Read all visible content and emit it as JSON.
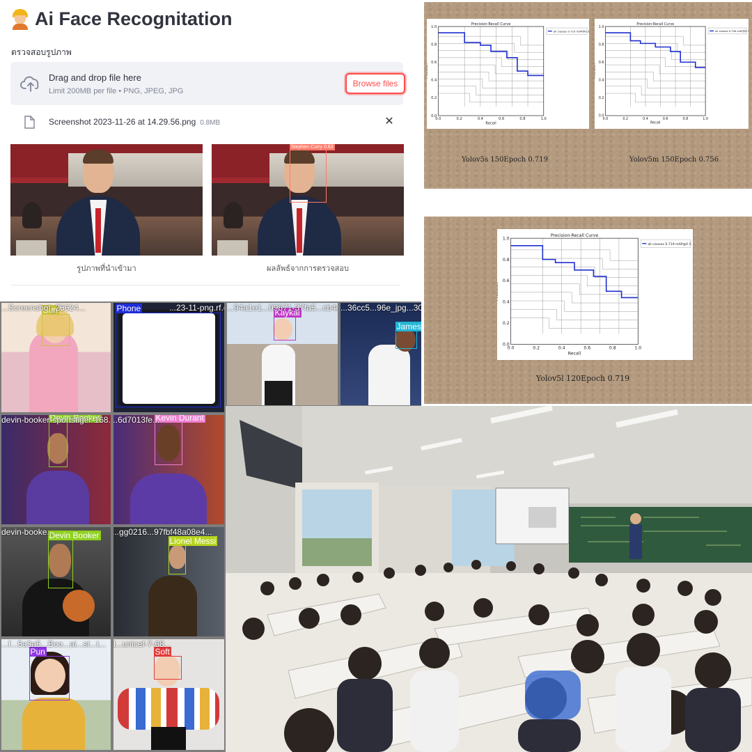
{
  "app": {
    "title": "Ai Face Recognitation",
    "title_icon": "construction-worker-icon",
    "uploader_label": "ตรวจสอบรูปภาพ",
    "dropzone": {
      "main_text": "Drag and drop file here",
      "sub_text": "Limit 200MB per file • PNG, JPEG, JPG",
      "browse_label": "Browse files"
    },
    "uploaded_file": {
      "name": "Screenshot 2023-11-26 at 14.29.56.png",
      "size": "0.8MB"
    },
    "images": [
      {
        "caption": "รูปภาพที่นำเข้ามา"
      },
      {
        "caption": "ผลลัพธ์จากการตรวจสอบ",
        "detection_label": "Stephen Curry 0.63"
      }
    ],
    "accent_color": "#ff4b4b"
  },
  "pr_curves": [
    {
      "caption": "Yolov5s 150Epoch 0.719",
      "legend": "all classes 0.719 mAP@0.5"
    },
    {
      "caption": "Yolov5m 150Epoch 0.756",
      "legend": "all classes 0.756 mAP@0.5"
    },
    {
      "caption": "Yolov5l 120Epoch 0.719",
      "legend": "all classes 0.719 mAP@0.5"
    }
  ],
  "chart_data": [
    {
      "type": "line",
      "title": "Precision-Recall Curve",
      "xlabel": "Recall",
      "ylabel": "Precision",
      "xlim": [
        0,
        1
      ],
      "ylim": [
        0,
        1
      ],
      "legend_position": "top-right",
      "series": [
        {
          "name": "all classes 0.719 mAP@0.5",
          "x": [
            0,
            0.25,
            0.25,
            0.4,
            0.4,
            0.5,
            0.5,
            0.65,
            0.65,
            0.75,
            0.75,
            0.85,
            0.85,
            1.0
          ],
          "y": [
            0.93,
            0.93,
            0.82,
            0.82,
            0.79,
            0.79,
            0.72,
            0.72,
            0.65,
            0.65,
            0.5,
            0.5,
            0.45,
            0.45
          ]
        }
      ]
    },
    {
      "type": "line",
      "title": "Precision-Recall Curve",
      "xlabel": "Recall",
      "ylabel": "Precision",
      "xlim": [
        0,
        1
      ],
      "ylim": [
        0,
        1
      ],
      "legend_position": "top-right",
      "series": [
        {
          "name": "all classes 0.756 mAP@0.5",
          "x": [
            0,
            0.25,
            0.25,
            0.35,
            0.35,
            0.5,
            0.5,
            0.65,
            0.65,
            0.75,
            0.75,
            0.9,
            0.9,
            1.0
          ],
          "y": [
            0.93,
            0.93,
            0.84,
            0.84,
            0.81,
            0.81,
            0.77,
            0.77,
            0.72,
            0.72,
            0.6,
            0.6,
            0.54,
            0.54
          ]
        }
      ]
    },
    {
      "type": "line",
      "title": "Precision-Recall Curve",
      "xlabel": "Recall",
      "ylabel": "Precision",
      "xlim": [
        0,
        1
      ],
      "ylim": [
        0,
        1
      ],
      "legend_position": "top-right",
      "series": [
        {
          "name": "all classes 0.719 mAP@0.5",
          "x": [
            0,
            0.25,
            0.25,
            0.35,
            0.35,
            0.5,
            0.5,
            0.65,
            0.65,
            0.75,
            0.75,
            0.87,
            0.87,
            1.0
          ],
          "y": [
            0.93,
            0.93,
            0.8,
            0.8,
            0.77,
            0.77,
            0.7,
            0.7,
            0.64,
            0.64,
            0.5,
            0.5,
            0.44,
            0.44
          ]
        }
      ]
    }
  ],
  "detections": {
    "tiles": [
      {
        "filename": "...Screenshot_25624...",
        "label": "Sun",
        "color": "#c9c23a"
      },
      {
        "filename": "...23-11-png.rf.ca8a0...",
        "label": "Phone",
        "color": "#1e2bd6"
      },
      {
        "filename": "...94a1e1...09671-37fa5...cb4e...",
        "label": "Kaykai",
        "color": "#c136c8"
      },
      {
        "filename": "...36cc5...96e_jpg...307...",
        "label": "James",
        "color": "#22b6d6"
      },
      {
        "filename": "devin-booker-sportstiger-168...",
        "label": "Devin Booker",
        "color": "#8fd11e"
      },
      {
        "filename": "...d...ebatekbo...6d7013fe...",
        "label": "Kevin Durant",
        "color": "#ef7fd0"
      },
      {
        "filename": "devin-booke...",
        "label": "Devin Booker",
        "color": "#8fd11e"
      },
      {
        "filename": "...wnds...gg0216...97fbf48a08e4...",
        "label": "Lionel Messi",
        "color": "#b6d41e"
      },
      {
        "filename": "...f...5a3a5...Boo...ai...st...t...",
        "label": "Pun",
        "color": "#8e38e0"
      },
      {
        "filename": "...boi...d...unicef-7-68...",
        "label": "Soft",
        "color": "#e23a3a"
      }
    ]
  }
}
